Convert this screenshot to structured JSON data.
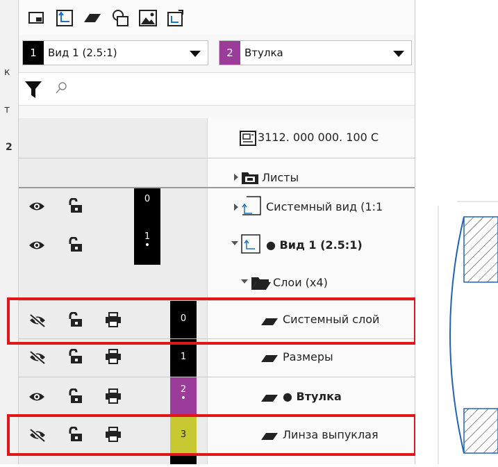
{
  "left_strip": {
    "glyphs": [
      "к",
      "т",
      "2"
    ]
  },
  "toolbar": {
    "icons": [
      "view-frame-icon",
      "local-cs-icon",
      "layer-icon",
      "shapes-icon",
      "image-icon",
      "refresh-view-icon"
    ]
  },
  "view_select": {
    "number": "1",
    "label": "Вид 1 (2.5:1)",
    "color": "#000000"
  },
  "layer_select": {
    "number": "2",
    "label": "Втулка",
    "color": "#9b3c9b"
  },
  "filter": {
    "placeholder": "",
    "search_icon": "search-icon"
  },
  "tree": {
    "document": "3112. 000 000. 100 С",
    "sheets": "Листы",
    "system_view": {
      "number": "0",
      "label": "Системный вид (1:1"
    },
    "view1": {
      "number": "1",
      "dot": "•",
      "label": "● Вид 1 (2.5:1)"
    },
    "layers_folder": "Слои (x4)",
    "layers": [
      {
        "number": "0",
        "dot": "",
        "label": "Системный слой",
        "color": "#000000",
        "visible": false
      },
      {
        "number": "1",
        "dot": "",
        "label": "Размеры",
        "color": "#000000",
        "visible": false
      },
      {
        "number": "2",
        "dot": "•",
        "label": "● Втулка",
        "color": "#9b3c9b",
        "visible": true
      },
      {
        "number": "3",
        "dot": "",
        "label": "Линза выпуклая",
        "color": "#c8c832",
        "visible": false
      }
    ]
  },
  "colors": {
    "highlight": "#e0161b",
    "part_outline": "#1f63b5"
  }
}
